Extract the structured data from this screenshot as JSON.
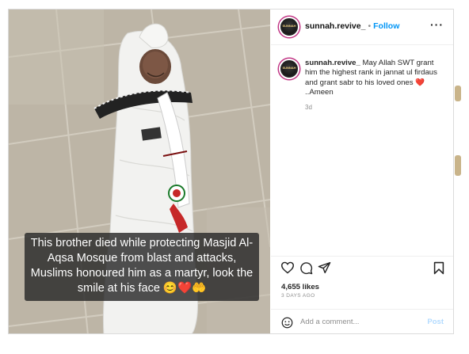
{
  "header": {
    "username": "sunnah.revive_",
    "separator": "•",
    "follow_label": "Follow",
    "more_label": "···",
    "avatar_text": "SUNNAH"
  },
  "comment": {
    "username": "sunnah.revive_",
    "text_before_heart": "May Allah SWT grant him the highest rank in jannat ul firdaus and grant sabr to his loved ones",
    "heart": "❤️",
    "text_after_heart": "..Ameen",
    "time": "3d"
  },
  "photo": {
    "caption": "This brother died while protecting Masjid Al-Aqsa Mosque from blast and attacks, Muslims honoured him as a martyr, look the smile at his face 😊❤️🤲"
  },
  "stats": {
    "likes": "4,655 likes",
    "ago": "3 DAYS AGO"
  },
  "add_comment": {
    "placeholder": "Add a comment...",
    "post_label": "Post"
  },
  "icons": [
    "like-icon",
    "comment-icon",
    "share-icon",
    "save-icon",
    "emoji-icon",
    "more-icon"
  ],
  "colors": {
    "follow": "#0095f6",
    "post_disabled": "#b3dbff",
    "heart": "#ed4956",
    "border": "#dbdbdb"
  }
}
